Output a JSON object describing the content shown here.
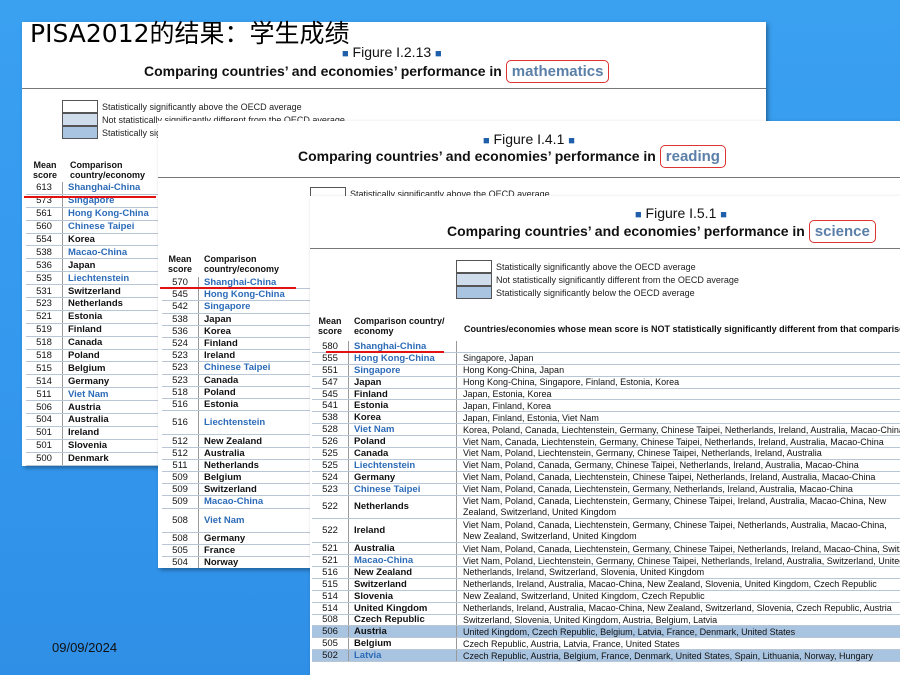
{
  "slide": {
    "title": "PISA2012的结果：学生成绩",
    "date": "09/09/2024"
  },
  "colors": {
    "background": "#3498ee",
    "highlight_line": "#e21212",
    "link_blue": "#2c6bb8"
  },
  "math": {
    "figure_label": "Figure I.2.13",
    "title_prefix": "Comparing countries’ and economies’ performance in ",
    "subject": "mathematics",
    "legend": [
      {
        "text": "Statistically significantly above the OECD average",
        "color": "#ffffff"
      },
      {
        "text": "Not statistically significantly different from the OECD average",
        "color": "#cfdcec"
      },
      {
        "text": "Statistically significantly below the OECD average",
        "color": "#a9c4e0"
      }
    ],
    "col_score": "Mean score",
    "col_country": "Comparison country/economy",
    "rows": [
      {
        "score": "613",
        "name": "Shanghai-China",
        "hl": true
      },
      {
        "score": "573",
        "name": "Singapore",
        "hl": true
      },
      {
        "score": "561",
        "name": "Hong Kong-China",
        "hl": true
      },
      {
        "score": "560",
        "name": "Chinese Taipei",
        "hl": true
      },
      {
        "score": "554",
        "name": "Korea",
        "hl": false
      },
      {
        "score": "538",
        "name": "Macao-China",
        "hl": true
      },
      {
        "score": "536",
        "name": "Japan",
        "hl": false
      },
      {
        "score": "535",
        "name": "Liechtenstein",
        "hl": true
      },
      {
        "score": "531",
        "name": "Switzerland",
        "hl": false
      },
      {
        "score": "523",
        "name": "Netherlands",
        "hl": false
      },
      {
        "score": "521",
        "name": "Estonia",
        "hl": false
      },
      {
        "score": "519",
        "name": "Finland",
        "hl": false
      },
      {
        "score": "518",
        "name": "Canada",
        "hl": false
      },
      {
        "score": "518",
        "name": "Poland",
        "hl": false
      },
      {
        "score": "515",
        "name": "Belgium",
        "hl": false
      },
      {
        "score": "514",
        "name": "Germany",
        "hl": false
      },
      {
        "score": "511",
        "name": "Viet Nam",
        "hl": true
      },
      {
        "score": "506",
        "name": "Austria",
        "hl": false
      },
      {
        "score": "504",
        "name": "Australia",
        "hl": false
      },
      {
        "score": "501",
        "name": "Ireland",
        "hl": false
      },
      {
        "score": "501",
        "name": "Slovenia",
        "hl": false
      },
      {
        "score": "500",
        "name": "Denmark",
        "hl": false
      }
    ]
  },
  "reading": {
    "figure_label": "Figure I.4.1",
    "title_prefix": "Comparing countries’ and economies’ performance in ",
    "subject": "reading",
    "legend": [
      {
        "text": "Statistically significantly above the OECD average",
        "color": "#ffffff"
      }
    ],
    "col_score": "Mean score",
    "col_country": "Comparison country/economy",
    "rows": [
      {
        "score": "570",
        "name": "Shanghai-China",
        "hl": true,
        "tall": false
      },
      {
        "score": "545",
        "name": "Hong Kong-China",
        "hl": true,
        "tall": false
      },
      {
        "score": "542",
        "name": "Singapore",
        "hl": true,
        "tall": false
      },
      {
        "score": "538",
        "name": "Japan",
        "hl": false,
        "tall": false
      },
      {
        "score": "536",
        "name": "Korea",
        "hl": false,
        "tall": false
      },
      {
        "score": "524",
        "name": "Finland",
        "hl": false,
        "tall": false
      },
      {
        "score": "523",
        "name": "Ireland",
        "hl": false,
        "tall": false
      },
      {
        "score": "523",
        "name": "Chinese Taipei",
        "hl": true,
        "tall": false
      },
      {
        "score": "523",
        "name": "Canada",
        "hl": false,
        "tall": false
      },
      {
        "score": "518",
        "name": "Poland",
        "hl": false,
        "tall": false
      },
      {
        "score": "516",
        "name": "Estonia",
        "hl": false,
        "tall": false
      },
      {
        "score": "516",
        "name": "Liechtenstein",
        "hl": true,
        "tall": true
      },
      {
        "score": "512",
        "name": "New Zealand",
        "hl": false,
        "tall": false
      },
      {
        "score": "512",
        "name": "Australia",
        "hl": false,
        "tall": false
      },
      {
        "score": "511",
        "name": "Netherlands",
        "hl": false,
        "tall": false
      },
      {
        "score": "509",
        "name": "Belgium",
        "hl": false,
        "tall": false
      },
      {
        "score": "509",
        "name": "Switzerland",
        "hl": false,
        "tall": false
      },
      {
        "score": "509",
        "name": "Macao-China",
        "hl": true,
        "tall": false
      },
      {
        "score": "508",
        "name": "Viet Nam",
        "hl": true,
        "tall": true
      },
      {
        "score": "508",
        "name": "Germany",
        "hl": false,
        "tall": false
      },
      {
        "score": "505",
        "name": "France",
        "hl": false,
        "tall": false
      },
      {
        "score": "504",
        "name": "Norway",
        "hl": false,
        "tall": false
      }
    ]
  },
  "science": {
    "figure_label": "Figure I.5.1",
    "title_prefix": "Comparing countries’ and economies’ performance in ",
    "subject": "science",
    "legend": [
      {
        "text": "Statistically significantly above the OECD average",
        "color": "#ffffff"
      },
      {
        "text": "Not statistically significantly different from the OECD average",
        "color": "#cfdcec"
      },
      {
        "text": "Statistically significantly below the OECD average",
        "color": "#a9c4e0"
      }
    ],
    "col_score": "Mean score",
    "col_country": "Comparison country/ economy",
    "col_compare": "Countries/economies whose mean score is NOT statistically significantly different from that comparison country",
    "rows": [
      {
        "score": "580",
        "name": "Shanghai-China",
        "hl": true,
        "cmp": "",
        "tall": false,
        "band": ""
      },
      {
        "score": "555",
        "name": "Hong Kong-China",
        "hl": true,
        "cmp": "Singapore, Japan",
        "tall": false,
        "band": ""
      },
      {
        "score": "551",
        "name": "Singapore",
        "hl": true,
        "cmp": "Hong Kong-China, Japan",
        "tall": false,
        "band": ""
      },
      {
        "score": "547",
        "name": "Japan",
        "hl": false,
        "cmp": "Hong Kong-China, Singapore, Finland, Estonia, Korea",
        "tall": false,
        "band": ""
      },
      {
        "score": "545",
        "name": "Finland",
        "hl": false,
        "cmp": "Japan, Estonia, Korea",
        "tall": false,
        "band": ""
      },
      {
        "score": "541",
        "name": "Estonia",
        "hl": false,
        "cmp": "Japan, Finland, Korea",
        "tall": false,
        "band": ""
      },
      {
        "score": "538",
        "name": "Korea",
        "hl": false,
        "cmp": "Japan, Finland, Estonia, Viet Nam",
        "tall": false,
        "band": ""
      },
      {
        "score": "528",
        "name": "Viet Nam",
        "hl": true,
        "cmp": "Korea, Poland, Canada, Liechtenstein, Germany, Chinese Taipei, Netherlands, Ireland, Australia, Macao-China",
        "tall": false,
        "band": ""
      },
      {
        "score": "526",
        "name": "Poland",
        "hl": false,
        "cmp": "Viet Nam, Canada, Liechtenstein, Germany, Chinese Taipei, Netherlands, Ireland, Australia, Macao-China",
        "tall": false,
        "band": ""
      },
      {
        "score": "525",
        "name": "Canada",
        "hl": false,
        "cmp": "Viet Nam, Poland, Liechtenstein, Germany, Chinese Taipei, Netherlands, Ireland, Australia",
        "tall": false,
        "band": ""
      },
      {
        "score": "525",
        "name": "Liechtenstein",
        "hl": true,
        "cmp": "Viet Nam, Poland, Canada, Germany, Chinese Taipei, Netherlands, Ireland, Australia, Macao-China",
        "tall": false,
        "band": ""
      },
      {
        "score": "524",
        "name": "Germany",
        "hl": false,
        "cmp": "Viet Nam, Poland, Canada, Liechtenstein, Chinese Taipei, Netherlands, Ireland, Australia, Macao-China",
        "tall": false,
        "band": ""
      },
      {
        "score": "523",
        "name": "Chinese Taipei",
        "hl": true,
        "cmp": "Viet Nam, Poland, Canada, Liechtenstein, Germany, Netherlands, Ireland, Australia, Macao-China",
        "tall": false,
        "band": ""
      },
      {
        "score": "522",
        "name": "Netherlands",
        "hl": false,
        "cmp": "Viet Nam, Poland, Canada, Liechtenstein, Germany, Chinese Taipei, Ireland, Australia, Macao-China, New Zealand, Switzerland, United Kingdom",
        "tall": true,
        "band": ""
      },
      {
        "score": "522",
        "name": "Ireland",
        "hl": false,
        "cmp": "Viet Nam, Poland, Canada, Liechtenstein, Germany, Chinese Taipei, Netherlands, Australia, Macao-China, New Zealand, Switzerland, United Kingdom",
        "tall": true,
        "band": ""
      },
      {
        "score": "521",
        "name": "Australia",
        "hl": false,
        "cmp": "Viet Nam, Poland, Canada, Liechtenstein, Germany, Chinese Taipei, Netherlands, Ireland, Macao-China, Switzerland",
        "tall": false,
        "band": ""
      },
      {
        "score": "521",
        "name": "Macao-China",
        "hl": true,
        "cmp": "Viet Nam, Poland, Liechtenstein, Germany, Chinese Taipei, Netherlands, Ireland, Australia, Switzerland, United Kingdom",
        "tall": false,
        "band": ""
      },
      {
        "score": "516",
        "name": "New Zealand",
        "hl": false,
        "cmp": "Netherlands, Ireland, Switzerland, Slovenia, United Kingdom",
        "tall": false,
        "band": ""
      },
      {
        "score": "515",
        "name": "Switzerland",
        "hl": false,
        "cmp": "Netherlands, Ireland, Australia, Macao-China, New Zealand, Slovenia, United Kingdom, Czech Republic",
        "tall": false,
        "band": ""
      },
      {
        "score": "514",
        "name": "Slovenia",
        "hl": false,
        "cmp": "New Zealand, Switzerland, United Kingdom, Czech Republic",
        "tall": false,
        "band": ""
      },
      {
        "score": "514",
        "name": "United Kingdom",
        "hl": false,
        "cmp": "Netherlands, Ireland, Australia, Macao-China, New Zealand, Switzerland, Slovenia, Czech Republic, Austria",
        "tall": false,
        "band": ""
      },
      {
        "score": "508",
        "name": "Czech Republic",
        "hl": false,
        "cmp": "Switzerland, Slovenia, United Kingdom, Austria, Belgium, Latvia",
        "tall": false,
        "band": ""
      },
      {
        "score": "506",
        "name": "Austria",
        "hl": false,
        "cmp": "United Kingdom, Czech Republic, Belgium, Latvia, France, Denmark, United States",
        "tall": false,
        "band": "mid"
      },
      {
        "score": "505",
        "name": "Belgium",
        "hl": false,
        "cmp": "Czech Republic, Austria, Latvia, France, United States",
        "tall": false,
        "band": ""
      },
      {
        "score": "502",
        "name": "Latvia",
        "hl": true,
        "cmp": "Czech Republic, Austria, Belgium, France, Denmark, United States, Spain, Lithuania, Norway, Hungary",
        "tall": false,
        "band": "mid"
      }
    ]
  }
}
